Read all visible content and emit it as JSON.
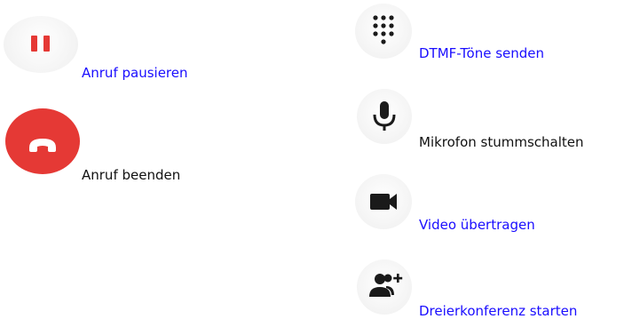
{
  "actions": {
    "pause": {
      "label": "Anruf pausieren",
      "icon": "pause-icon",
      "color": "#e53935",
      "link": true
    },
    "hangup": {
      "label": "Anruf beenden",
      "icon": "phone-hangup-icon",
      "color": "#e53935",
      "link": false
    },
    "dtmf": {
      "label": "DTMF-Töne senden",
      "icon": "dialpad-icon",
      "color": "#1a1a1a",
      "link": true
    },
    "mute": {
      "label": "Mikrofon stummschalten",
      "icon": "microphone-icon",
      "color": "#1a1a1a",
      "link": false
    },
    "video": {
      "label": "Video übertragen",
      "icon": "video-camera-icon",
      "color": "#1a1a1a",
      "link": true
    },
    "conference": {
      "label": "Dreierkonferenz starten",
      "icon": "add-person-icon",
      "color": "#1a1a1a",
      "link": true
    }
  },
  "colors": {
    "link": "#1a0dff",
    "text": "#111111",
    "hangup_bg": "#e53935",
    "icon_bg": "#f3f3f3"
  }
}
